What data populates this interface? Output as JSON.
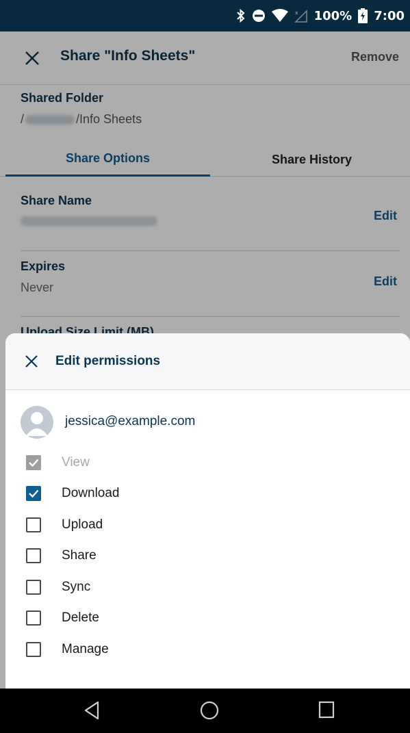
{
  "status_bar": {
    "battery": "100%",
    "time": "7:00",
    "icons": [
      "bluetooth-icon",
      "do-not-disturb-icon",
      "wifi-icon",
      "signal-icon",
      "battery-charging-icon"
    ]
  },
  "toolbar": {
    "title": "Share \"Info Sheets\"",
    "remove_label": "Remove"
  },
  "folder": {
    "label": "Shared Folder",
    "path_prefix": "/",
    "path_suffix": "/Info Sheets"
  },
  "tabs": [
    {
      "label": "Share Options",
      "active": true
    },
    {
      "label": "Share History",
      "active": false
    }
  ],
  "settings": {
    "share_name": {
      "label": "Share Name",
      "edit": "Edit"
    },
    "expires": {
      "label": "Expires",
      "value": "Never",
      "edit": "Edit"
    },
    "upload_limit": {
      "label": "Upload Size Limit (MB)"
    }
  },
  "sheet": {
    "title": "Edit permissions",
    "email": "jessica@example.com",
    "permissions": [
      {
        "label": "View",
        "checked": true,
        "disabled": true
      },
      {
        "label": "Download",
        "checked": true,
        "disabled": false
      },
      {
        "label": "Upload",
        "checked": false,
        "disabled": false
      },
      {
        "label": "Share",
        "checked": false,
        "disabled": false
      },
      {
        "label": "Sync",
        "checked": false,
        "disabled": false
      },
      {
        "label": "Delete",
        "checked": false,
        "disabled": false
      },
      {
        "label": "Manage",
        "checked": false,
        "disabled": false
      }
    ]
  },
  "colors": {
    "status_bar": "#072a3f",
    "accent": "#0c5e93",
    "heading": "#0c3550"
  },
  "navbar": {
    "icons": [
      "back-icon",
      "home-icon",
      "recents-icon"
    ]
  }
}
